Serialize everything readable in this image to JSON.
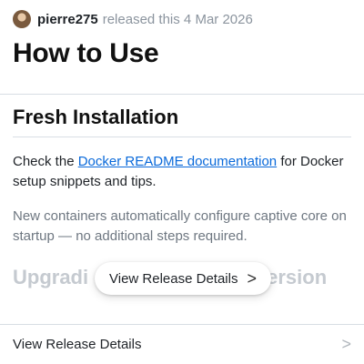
{
  "release": {
    "author": "pierre275",
    "released_text": "released this 4 Mar 2026"
  },
  "page": {
    "title": "How to Use"
  },
  "section": {
    "title": "Fresh Installation",
    "para1_prefix": "Check the ",
    "para1_link": "Docker README documentation",
    "para1_suffix": " for Docker setup snippets and tips.",
    "para2": "New containers automatically configure captive core on startup — no additional steps required.",
    "next_heading_visible": "Upgradi",
    "next_heading_visible_end": "ersion"
  },
  "popup": {
    "label": "View Release Details",
    "chevron": ">"
  },
  "footer_row": {
    "label": "View Release Details",
    "chevron": ">"
  },
  "icons": {
    "avatar": "user-avatar",
    "popup_chevron": "chevron-right-icon",
    "row_chevron": "chevron-right-icon"
  },
  "colors": {
    "link": "#0969da",
    "muted_text": "#6e7781",
    "divider": "#d8dee4"
  }
}
